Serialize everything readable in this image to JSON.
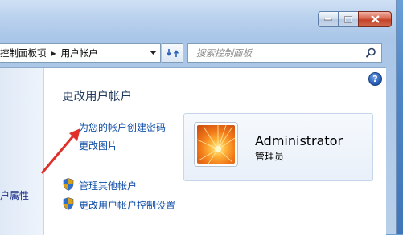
{
  "addressbar": {
    "crumbs": [
      "控制面板项",
      "用户帐户"
    ]
  },
  "search": {
    "placeholder": "搜索控制面板"
  },
  "sidebar": {
    "partial_link": "户属性"
  },
  "main": {
    "title": "更改用户帐户",
    "links": {
      "create_password": "为您的帐户创建密码",
      "change_picture": "更改图片",
      "manage_accounts": "管理其他帐户",
      "uac_settings": "更改用户帐户控制设置"
    },
    "user": {
      "name": "Administrator",
      "role": "管理员"
    }
  },
  "help": {
    "glyph": "?"
  },
  "colors": {
    "link": "#0f4ea8",
    "title": "#1e395b",
    "annotation_arrow": "#e0302a"
  }
}
